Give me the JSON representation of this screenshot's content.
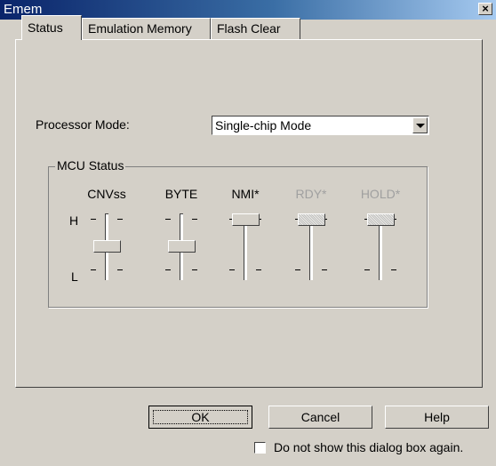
{
  "window": {
    "title": "Emem",
    "close_glyph": "×"
  },
  "tabs": [
    {
      "label": "Status",
      "active": true
    },
    {
      "label": "Emulation Memory",
      "active": false
    },
    {
      "label": "Flash Clear",
      "active": false
    }
  ],
  "processor_mode": {
    "label": "Processor Mode:",
    "value": "Single-chip Mode"
  },
  "mcu_status": {
    "title": "MCU Status",
    "high_label": "H",
    "low_label": "L",
    "channels": [
      {
        "name": "CNVss",
        "level": "L",
        "enabled": true
      },
      {
        "name": "BYTE",
        "level": "L",
        "enabled": true
      },
      {
        "name": "NMI*",
        "level": "H",
        "enabled": true
      },
      {
        "name": "RDY*",
        "level": "H",
        "enabled": false
      },
      {
        "name": "HOLD*",
        "level": "H",
        "enabled": false
      }
    ]
  },
  "buttons": {
    "ok": "OK",
    "cancel": "Cancel",
    "help": "Help"
  },
  "dont_show": {
    "label": "Do not show this dialog box again.",
    "checked": false
  }
}
